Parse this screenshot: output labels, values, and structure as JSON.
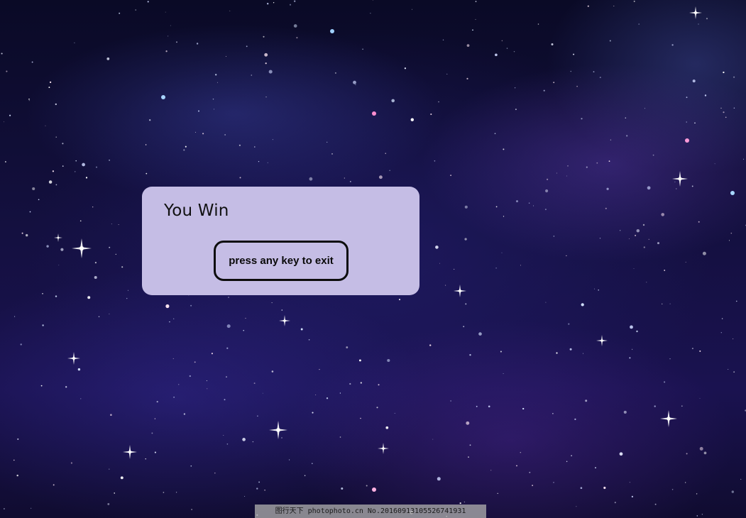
{
  "dialog": {
    "title": "You Win",
    "exit_button_label": "press any key to exit"
  },
  "watermark": {
    "text": "图行天下 photophoto.cn  No.20160913105526741931"
  },
  "colors": {
    "dialog_background": "#c5bde5",
    "button_border": "#0d0d0d",
    "space_dark": "#0b0a2e",
    "space_purple": "#1a1250"
  }
}
